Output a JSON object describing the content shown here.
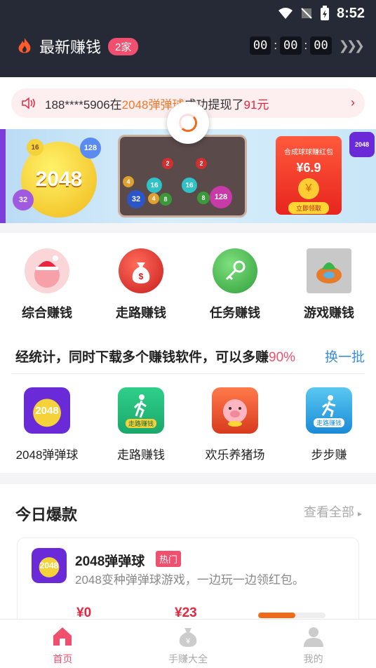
{
  "status_bar": {
    "time": "8:52"
  },
  "header": {
    "title": "最新赚钱",
    "badge": "2家",
    "timer": {
      "h": "00",
      "m": "00",
      "s": "00"
    }
  },
  "notice": {
    "prefix": "188****5906在",
    "game": "2048弹弹球",
    "middle": "成功提现了",
    "amount": "91元"
  },
  "banner": {
    "logo_text": "2048",
    "redpack_title": "合成球球赚红包",
    "redpack_amount": "¥6.9",
    "redpack_button": "立即领取",
    "balls": [
      "16",
      "128",
      "32",
      "4",
      "2",
      "8"
    ]
  },
  "categories": [
    {
      "label": "综合赚钱",
      "icon": "santa-peach-icon",
      "color": "#f6c0c4"
    },
    {
      "label": "走路赚钱",
      "icon": "money-bag-icon",
      "color": "#d9262b"
    },
    {
      "label": "任务赚钱",
      "icon": "key-icon",
      "color": "#3bb54a"
    },
    {
      "label": "游戏赚钱",
      "icon": "game-icon",
      "color": "#e67b2a"
    }
  ],
  "stats": {
    "text": "经统计，同时下载多个赚钱软件，可以多赚",
    "percent": "90%",
    "swap": "换一批"
  },
  "apps": [
    {
      "label": "2048弹弹球",
      "icon_text": "2048"
    },
    {
      "label": "走路赚钱",
      "icon_text": "走路赚钱"
    },
    {
      "label": "欢乐养猪场",
      "icon_text": ""
    },
    {
      "label": "步步赚",
      "icon_text": "走路赚钱"
    }
  ],
  "today": {
    "heading": "今日爆款",
    "more": "查看全部",
    "card": {
      "icon_text": "2048",
      "name": "2048弹弹球",
      "tag": "热门",
      "desc": "2048变种弹弹球游戏，一边玩一边领红包。",
      "price1": "¥0",
      "price2": "¥23",
      "progress": 0.55
    }
  },
  "tabbar": [
    {
      "label": "首页",
      "icon": "home-icon",
      "active": true
    },
    {
      "label": "手赚大全",
      "icon": "money-bag-icon",
      "active": false
    },
    {
      "label": "我的",
      "icon": "user-icon",
      "active": false
    }
  ]
}
